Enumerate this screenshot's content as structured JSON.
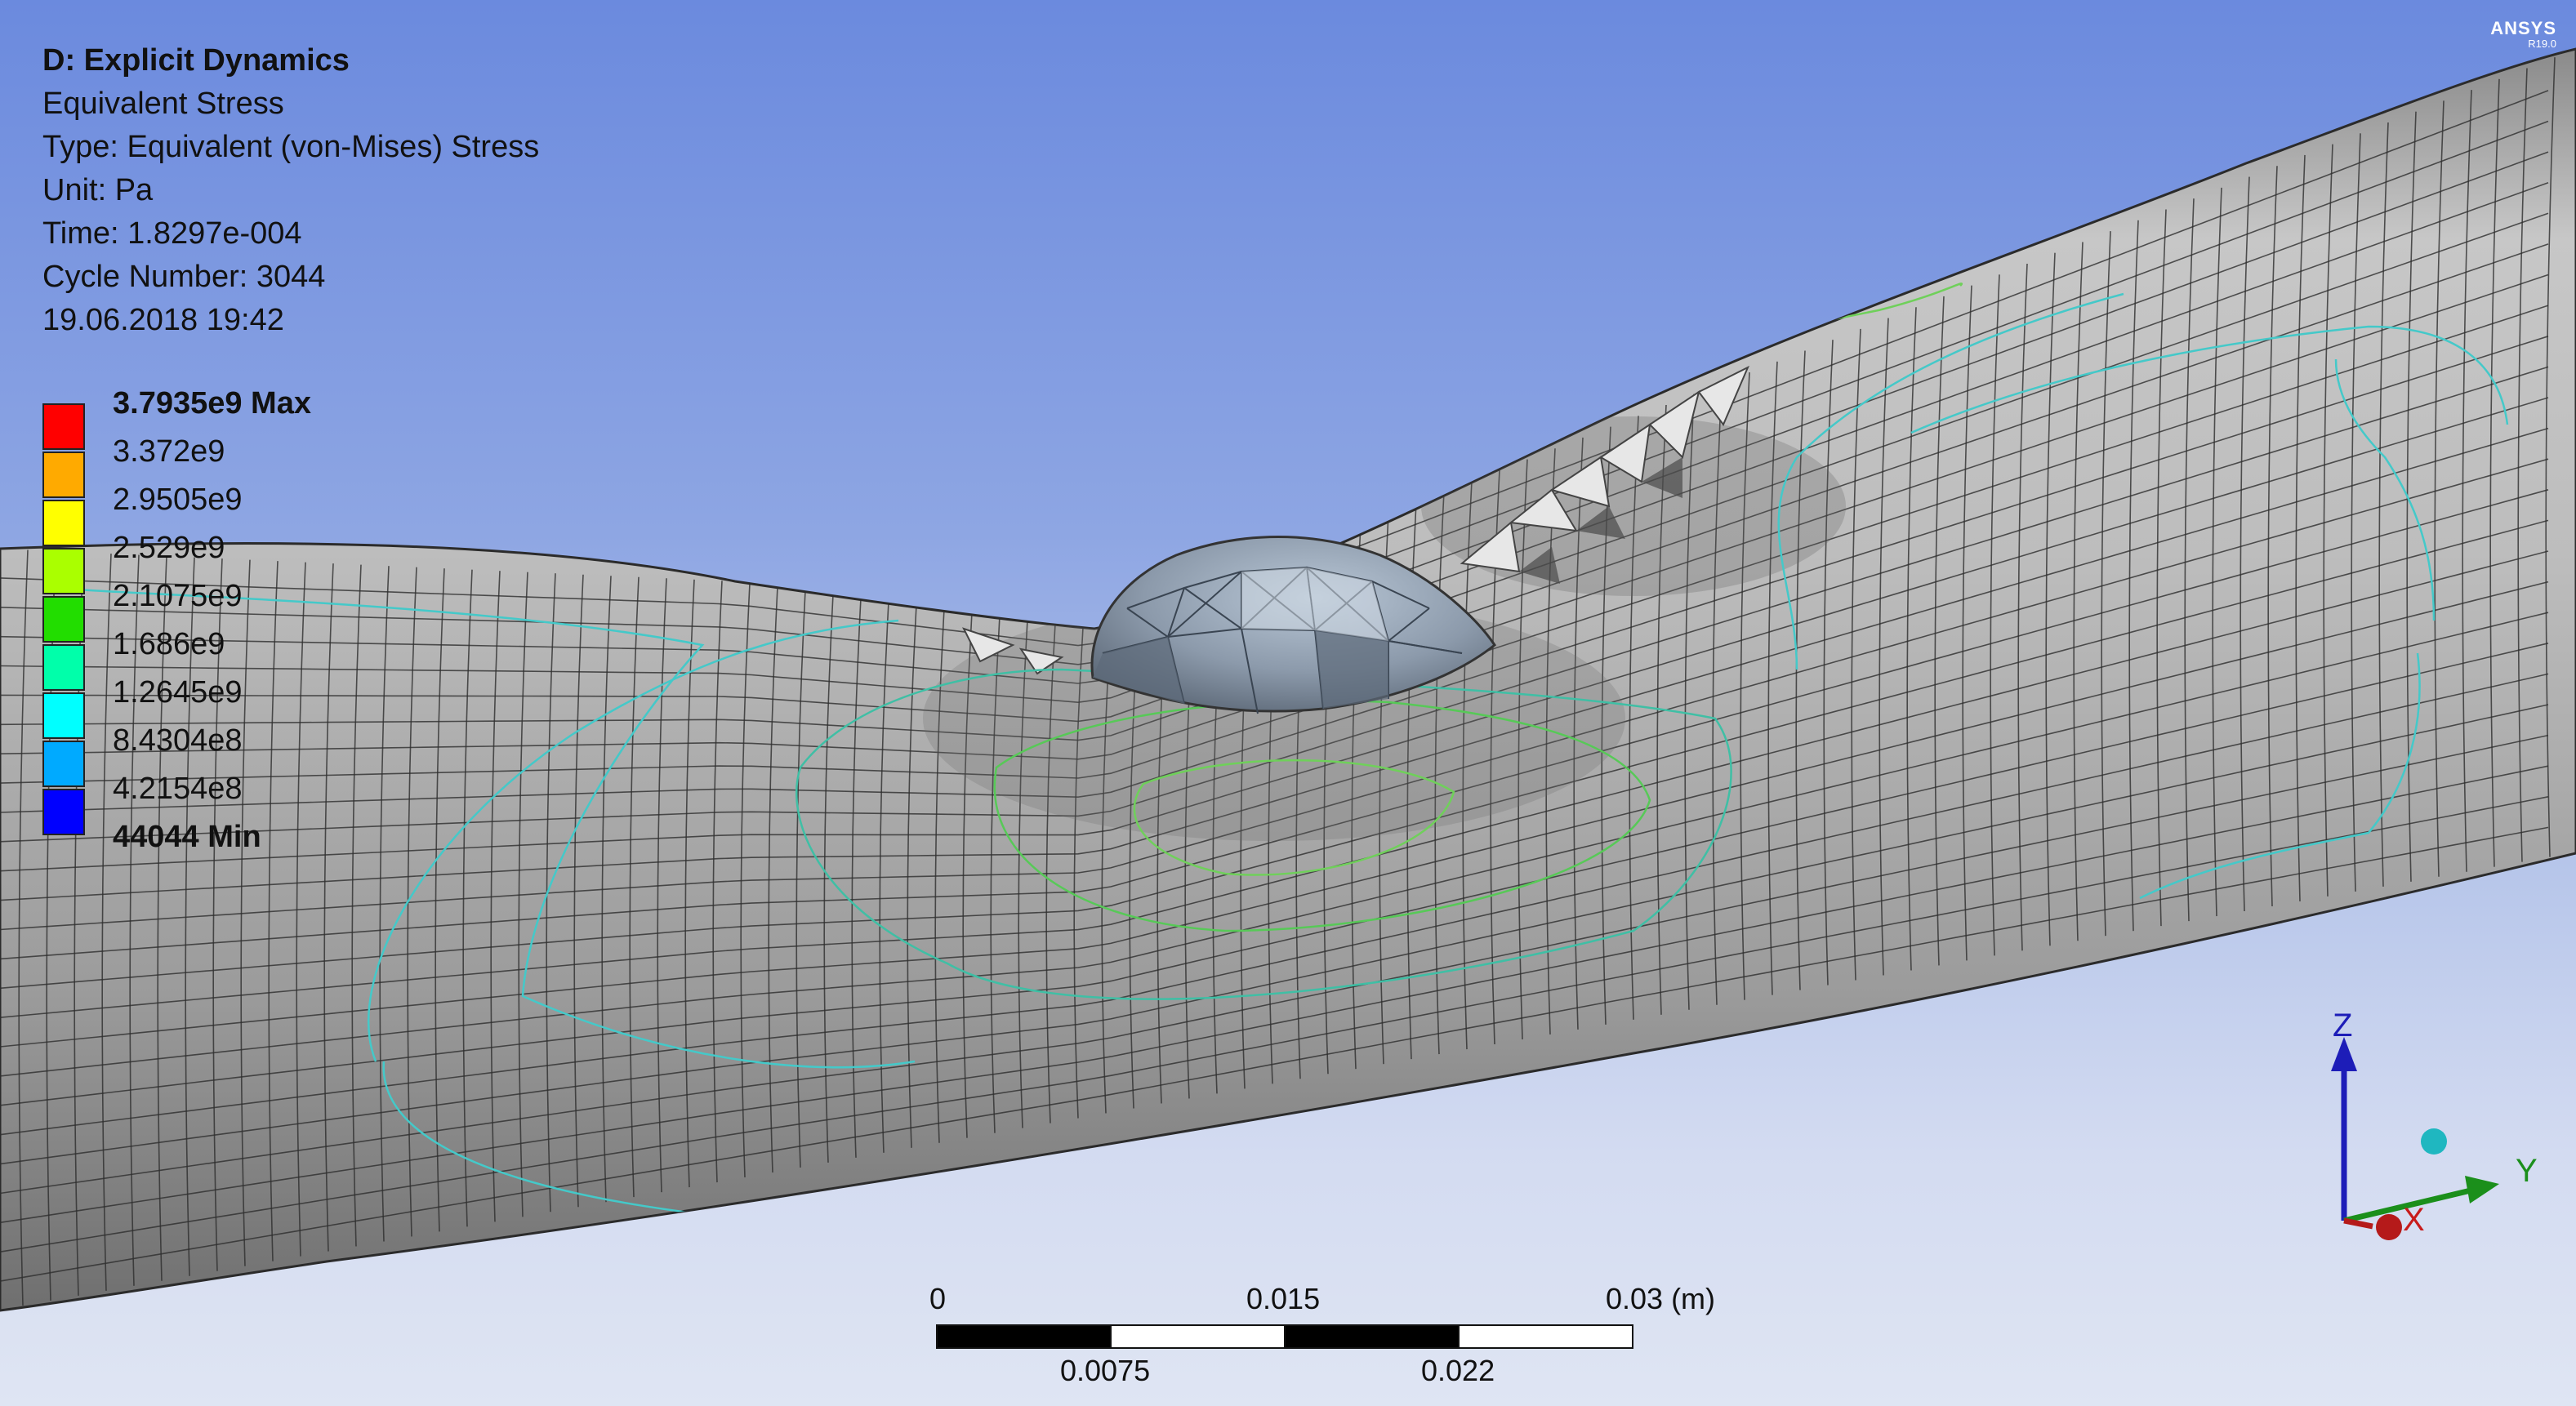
{
  "header": {
    "title": "D: Explicit Dynamics",
    "result_name": "Equivalent Stress",
    "type": "Type: Equivalent (von-Mises) Stress",
    "unit": "Unit: Pa",
    "time": "Time: 1.8297e-004",
    "cycle": "Cycle Number: 3044",
    "datetime": "19.06.2018 19:42"
  },
  "legend": {
    "labels": [
      "3.7935e9 Max",
      "3.372e9",
      "2.9505e9",
      "2.529e9",
      "2.1075e9",
      "1.686e9",
      "1.2645e9",
      "8.4304e8",
      "4.2154e8",
      "44044 Min"
    ],
    "colors": [
      "#ff0000",
      "#ffaa00",
      "#ffff00",
      "#aaff00",
      "#22dd00",
      "#00ffaa",
      "#00ffff",
      "#00aaff",
      "#0000ff"
    ]
  },
  "brand": {
    "name": "ANSYS",
    "version": "R19.0"
  },
  "scale_bar": {
    "top_labels": [
      "0",
      "0.015",
      "0.03 (m)"
    ],
    "bottom_labels": [
      "0.0075",
      "0.022"
    ]
  },
  "triad": {
    "z_label": "Z",
    "y_label": "Y",
    "x_label": "X"
  }
}
